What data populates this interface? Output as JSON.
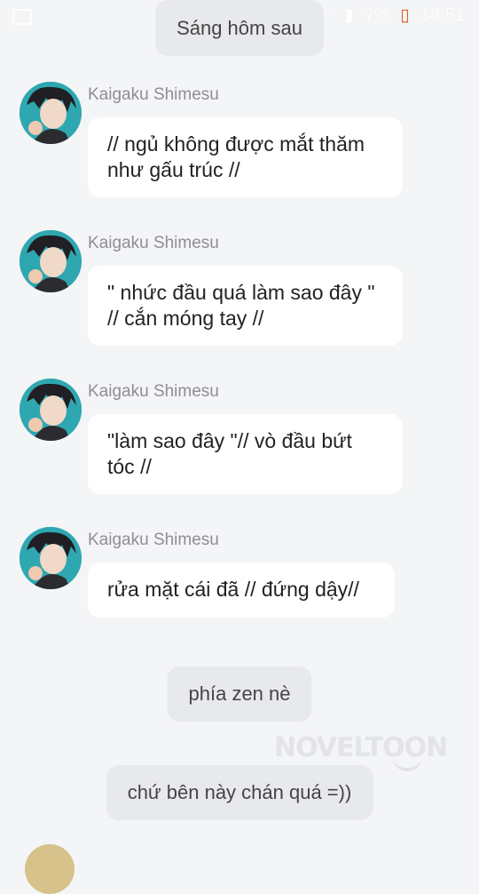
{
  "status_bar": {
    "battery": "7%",
    "time": "18:51"
  },
  "narrations": [
    {
      "text": "Sáng hôm sau"
    },
    {
      "text": "phía zen nè"
    },
    {
      "text": "chứ bên này chán quá =))"
    }
  ],
  "messages": [
    {
      "sender": "Kaigaku Shimesu",
      "text": "// ngủ không được mắt thăm như gấu trúc //"
    },
    {
      "sender": "Kaigaku Shimesu",
      "text": "\" nhức đầu quá làm sao đây \" // cắn móng tay //"
    },
    {
      "sender": "Kaigaku Shimesu",
      "text": "\"làm sao đây \"// vò đầu bứt tóc //"
    },
    {
      "sender": "Kaigaku Shimesu",
      "text": "rửa mặt cái đã // đứng dậy//"
    }
  ],
  "watermark": "NOVELTOON",
  "colors": {
    "background": "#f4f5f7",
    "narration_bubble": "#e8e9ec",
    "message_bubble": "#ffffff",
    "sender_name": "#8e8e93",
    "avatar_bg": "#2fa7b1"
  }
}
